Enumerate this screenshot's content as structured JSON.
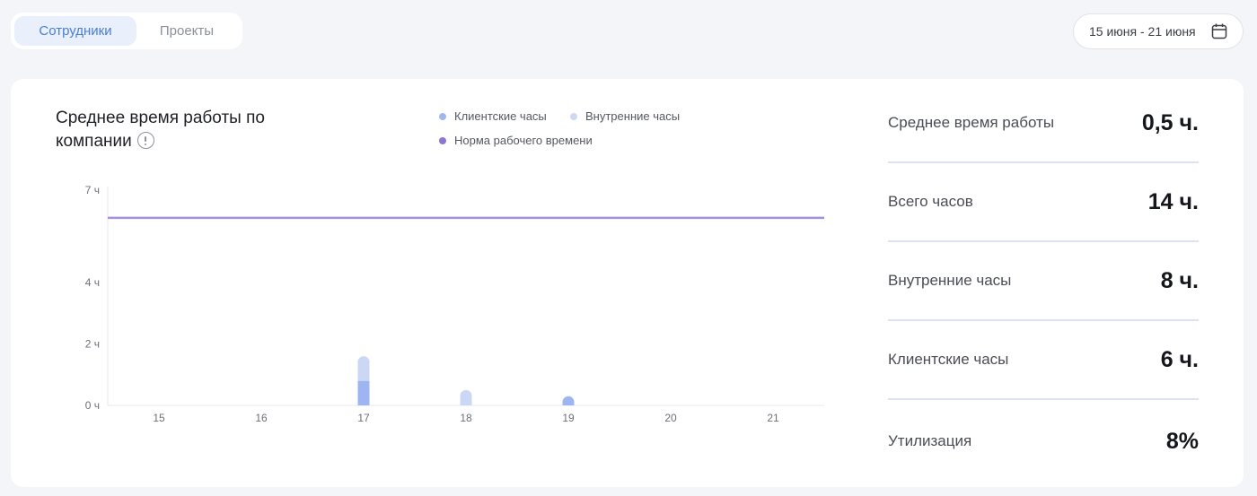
{
  "tabs": [
    {
      "label": "Сотрудники",
      "active": true
    },
    {
      "label": "Проекты",
      "active": false
    }
  ],
  "date_range": {
    "label": "15 июня - 21 июня",
    "icon": "calendar-icon"
  },
  "card": {
    "title": "Среднее время работы по компании",
    "title_icon": "info-icon",
    "legend": [
      {
        "label": "Клиентские часы",
        "color": "#9fb9ee"
      },
      {
        "label": "Внутренние часы",
        "color": "#cdd9f4"
      },
      {
        "label": "Норма рабочего времени",
        "color": "#8f74d8"
      }
    ]
  },
  "chart_data": {
    "type": "bar",
    "categories": [
      "15",
      "16",
      "17",
      "18",
      "19",
      "20",
      "21"
    ],
    "y_ticks": [
      {
        "value": 0,
        "label": "0 ч"
      },
      {
        "value": 2,
        "label": "2 ч"
      },
      {
        "value": 4,
        "label": "4 ч"
      },
      {
        "value": 7,
        "label": "7 ч"
      }
    ],
    "ylim": [
      0,
      7
    ],
    "series": [
      {
        "name": "Клиентские часы",
        "color": "#9db6f2",
        "values": [
          0,
          0,
          0.8,
          0,
          0.3,
          0,
          0
        ]
      },
      {
        "name": "Внутренние часы",
        "color": "#cbd7f4",
        "values": [
          0,
          0,
          0.8,
          0.5,
          0,
          0,
          0
        ]
      }
    ],
    "reference_line": {
      "name": "Норма рабочего времени",
      "value": 6.1,
      "color": "#a690dc"
    },
    "stacked": true,
    "grid": false
  },
  "stats": [
    {
      "label": "Среднее время работы",
      "value": "0,5 ч."
    },
    {
      "label": "Всего часов",
      "value": "14 ч."
    },
    {
      "label": "Внутренние часы",
      "value": "8 ч."
    },
    {
      "label": "Клиентские часы",
      "value": "6 ч."
    },
    {
      "label": "Утилизация",
      "value": "8%"
    }
  ]
}
